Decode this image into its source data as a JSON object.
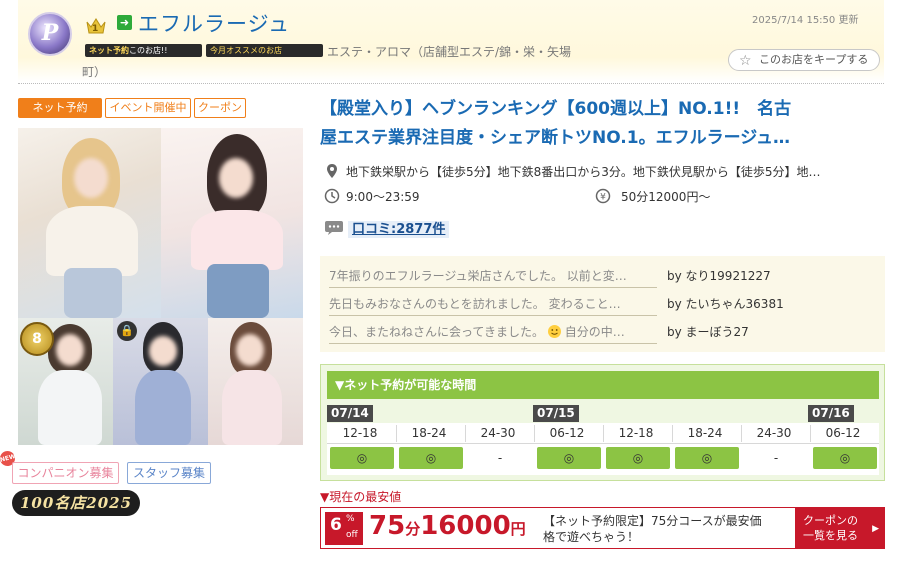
{
  "header": {
    "shop_logo_letter": "P",
    "rank_number": "1",
    "shop_name": "エフルラージュ",
    "updated": "2025/7/14 15:50 更新",
    "badge_net": "ネット予約",
    "badge_net_suffix": "このお店!!",
    "badge_recommend": "今月オススメのお店",
    "genre_line1": "エステ・アロマ（店舗型エステ/錦・栄・矢場",
    "genre_line2": "町）",
    "keep_label": "このお店をキープする"
  },
  "tags": [
    "ネット予約",
    "イベント開催中",
    "クーポン"
  ],
  "photos": {
    "award_mark": "8",
    "lock_icon": "lock-icon"
  },
  "recruit": {
    "new_badge": "NEW",
    "companion": "コンパニオン募集",
    "staff": "スタッフ募集",
    "meiten": "100名店2025"
  },
  "headline": {
    "line1": "【殿堂入り】ヘブンランキング【600週以上】NO.1!!　名古",
    "line2": "屋エステ業界注目度・シェア断トツNO.1。エフルラージュ…"
  },
  "info": {
    "access": "地下鉄栄駅から【徒歩5分】地下鉄8番出口から3分。地下鉄伏見駅から【徒歩5分】地…",
    "hours": "9:00〜23:59",
    "price": "50分12000円〜",
    "review_count_link": "口コミ:2877件"
  },
  "reviews": [
    {
      "text": "7年振りのエフルラージュ栄店さんでした。 以前と変…",
      "by": "by なり19921227"
    },
    {
      "text": "先日もみおなさんのもとを訪れました。 変わること…",
      "by": "by たいちゃん36381"
    },
    {
      "text_before": "今日、またねねさんに会ってきました。",
      "text_after": " 自分の中…",
      "by": "by まーぼう27"
    }
  ],
  "schedule": {
    "title": "▼ネット予約が可能な時間",
    "dates": [
      "07/14",
      "07/15",
      "07/16"
    ],
    "slots": [
      {
        "time": "12-18",
        "mark": "◎"
      },
      {
        "time": "18-24",
        "mark": "◎"
      },
      {
        "time": "24-30",
        "mark": "-"
      },
      {
        "time": "06-12",
        "mark": "◎"
      },
      {
        "time": "12-18",
        "mark": "◎"
      },
      {
        "time": "18-24",
        "mark": "◎"
      },
      {
        "time": "24-30",
        "mark": "-"
      },
      {
        "time": "06-12",
        "mark": "◎"
      }
    ]
  },
  "lowest": {
    "label": "▼現在の最安値",
    "pct_number": "6",
    "pct_sign": "%",
    "pct_off": "off",
    "minutes": "75",
    "minutes_unit": "分",
    "yen": "16000",
    "yen_unit": "円",
    "deal_text": "【ネット予約限定】75分コースが最安価格で遊べちゃう！",
    "coupon_line1": "クーポンの",
    "coupon_line2": "一覧を見る",
    "coupon_arrow": "▶"
  },
  "colors": {
    "link_blue": "#1a6ab3",
    "orange": "#f07f1a",
    "green": "#8cc444",
    "red": "#c7182a"
  }
}
